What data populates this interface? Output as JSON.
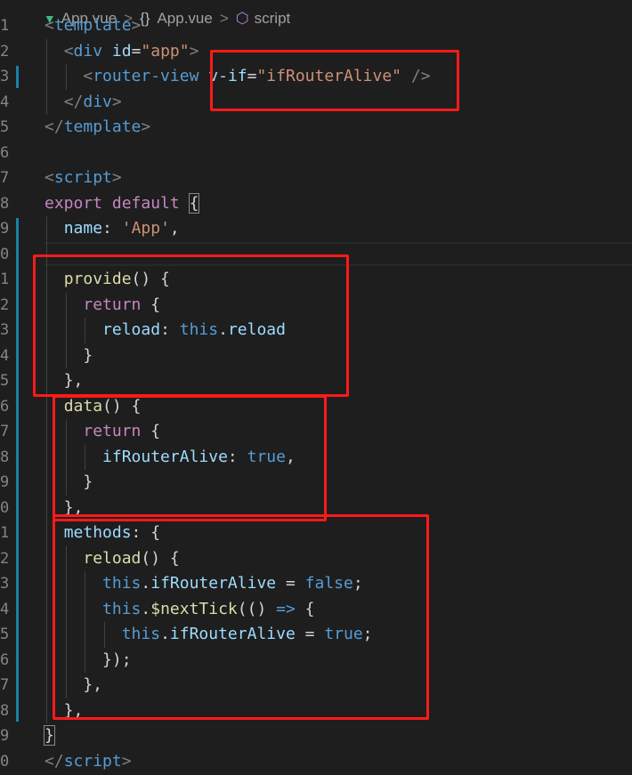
{
  "breadcrumb": {
    "file": "App.vue",
    "braces": "{}",
    "component": "App.vue",
    "section": "script",
    "separator": ">"
  },
  "editor": {
    "colors": {
      "background": "#1e1e1e",
      "tag": "#569cd6",
      "punctuation": "#808080",
      "attribute": "#9cdcfe",
      "string": "#ce9178",
      "keyword": "#c586c0",
      "function": "#dcdcaa",
      "plain": "#d4d4d4",
      "highlight_box": "#ff1a1a",
      "modified_bar": "#1b81a8"
    },
    "line_numbers": [
      "1",
      "2",
      "3",
      "4",
      "5",
      "6",
      "7",
      "8",
      "9",
      "0",
      "1",
      "2",
      "3",
      "4",
      "5",
      "6",
      "7",
      "8",
      "9",
      "0",
      "1",
      "2",
      "3",
      "4",
      "5",
      "6",
      "7",
      "8",
      "9",
      "0"
    ],
    "lines": [
      [
        [
          "t-punc",
          "<"
        ],
        [
          "t-tag",
          "template"
        ],
        [
          "t-punc",
          ">"
        ]
      ],
      [
        [
          "t-plain",
          "  "
        ],
        [
          "t-punc",
          "<"
        ],
        [
          "t-tag",
          "div"
        ],
        [
          "t-plain",
          " "
        ],
        [
          "t-attr",
          "id"
        ],
        [
          "t-plain",
          "="
        ],
        [
          "t-str",
          "\"app\""
        ],
        [
          "t-punc",
          ">"
        ]
      ],
      [
        [
          "t-plain",
          "    "
        ],
        [
          "t-punc",
          "<"
        ],
        [
          "t-tag",
          "router-view"
        ],
        [
          "t-plain",
          " "
        ],
        [
          "t-attr",
          "v-if"
        ],
        [
          "t-plain",
          "="
        ],
        [
          "t-str",
          "\"ifRouterAlive\""
        ],
        [
          "t-plain",
          " "
        ],
        [
          "t-punc",
          "/>"
        ]
      ],
      [
        [
          "t-plain",
          "  "
        ],
        [
          "t-punc",
          "</"
        ],
        [
          "t-tag",
          "div"
        ],
        [
          "t-punc",
          ">"
        ]
      ],
      [
        [
          "t-punc",
          "</"
        ],
        [
          "t-tag",
          "template"
        ],
        [
          "t-punc",
          ">"
        ]
      ],
      [],
      [
        [
          "t-punc",
          "<"
        ],
        [
          "t-tag",
          "script"
        ],
        [
          "t-punc",
          ">"
        ]
      ],
      [
        [
          "t-kw",
          "export"
        ],
        [
          "t-plain",
          " "
        ],
        [
          "t-kw",
          "default"
        ],
        [
          "t-plain",
          " "
        ],
        [
          "t-plain",
          "{"
        ]
      ],
      [
        [
          "t-plain",
          "  "
        ],
        [
          "t-prop",
          "name"
        ],
        [
          "t-plain",
          ": "
        ],
        [
          "t-str",
          "'App'"
        ],
        [
          "t-plain",
          ","
        ]
      ],
      [],
      [
        [
          "t-plain",
          "  "
        ],
        [
          "t-fn",
          "provide"
        ],
        [
          "t-plain",
          "() {"
        ]
      ],
      [
        [
          "t-plain",
          "    "
        ],
        [
          "t-kw",
          "return"
        ],
        [
          "t-plain",
          " {"
        ]
      ],
      [
        [
          "t-plain",
          "      "
        ],
        [
          "t-prop",
          "reload"
        ],
        [
          "t-plain",
          ": "
        ],
        [
          "t-const",
          "this"
        ],
        [
          "t-plain",
          "."
        ],
        [
          "t-prop",
          "reload"
        ]
      ],
      [
        [
          "t-plain",
          "    }"
        ]
      ],
      [
        [
          "t-plain",
          "  },"
        ]
      ],
      [
        [
          "t-plain",
          "  "
        ],
        [
          "t-fn",
          "data"
        ],
        [
          "t-plain",
          "() {"
        ]
      ],
      [
        [
          "t-plain",
          "    "
        ],
        [
          "t-kw",
          "return"
        ],
        [
          "t-plain",
          " {"
        ]
      ],
      [
        [
          "t-plain",
          "      "
        ],
        [
          "t-prop",
          "ifRouterAlive"
        ],
        [
          "t-plain",
          ": "
        ],
        [
          "t-const",
          "true"
        ],
        [
          "t-plain",
          ","
        ]
      ],
      [
        [
          "t-plain",
          "    }"
        ]
      ],
      [
        [
          "t-plain",
          "  },"
        ]
      ],
      [
        [
          "t-plain",
          "  "
        ],
        [
          "t-prop",
          "methods"
        ],
        [
          "t-plain",
          ": {"
        ]
      ],
      [
        [
          "t-plain",
          "    "
        ],
        [
          "t-fn",
          "reload"
        ],
        [
          "t-plain",
          "() {"
        ]
      ],
      [
        [
          "t-plain",
          "      "
        ],
        [
          "t-const",
          "this"
        ],
        [
          "t-plain",
          "."
        ],
        [
          "t-prop",
          "ifRouterAlive"
        ],
        [
          "t-plain",
          " = "
        ],
        [
          "t-const",
          "false"
        ],
        [
          "t-plain",
          ";"
        ]
      ],
      [
        [
          "t-plain",
          "      "
        ],
        [
          "t-const",
          "this"
        ],
        [
          "t-plain",
          "."
        ],
        [
          "t-fn",
          "$nextTick"
        ],
        [
          "t-plain",
          "(() "
        ],
        [
          "t-const",
          "=>"
        ],
        [
          "t-plain",
          " {"
        ]
      ],
      [
        [
          "t-plain",
          "        "
        ],
        [
          "t-const",
          "this"
        ],
        [
          "t-plain",
          "."
        ],
        [
          "t-prop",
          "ifRouterAlive"
        ],
        [
          "t-plain",
          " = "
        ],
        [
          "t-const",
          "true"
        ],
        [
          "t-plain",
          ";"
        ]
      ],
      [
        [
          "t-plain",
          "      });"
        ]
      ],
      [
        [
          "t-plain",
          "    },"
        ]
      ],
      [
        [
          "t-plain",
          "  },"
        ]
      ],
      [
        [
          "t-plain",
          "}"
        ]
      ],
      [
        [
          "t-punc",
          "</"
        ],
        [
          "t-tag",
          "script"
        ],
        [
          "t-punc",
          ">"
        ]
      ]
    ]
  }
}
